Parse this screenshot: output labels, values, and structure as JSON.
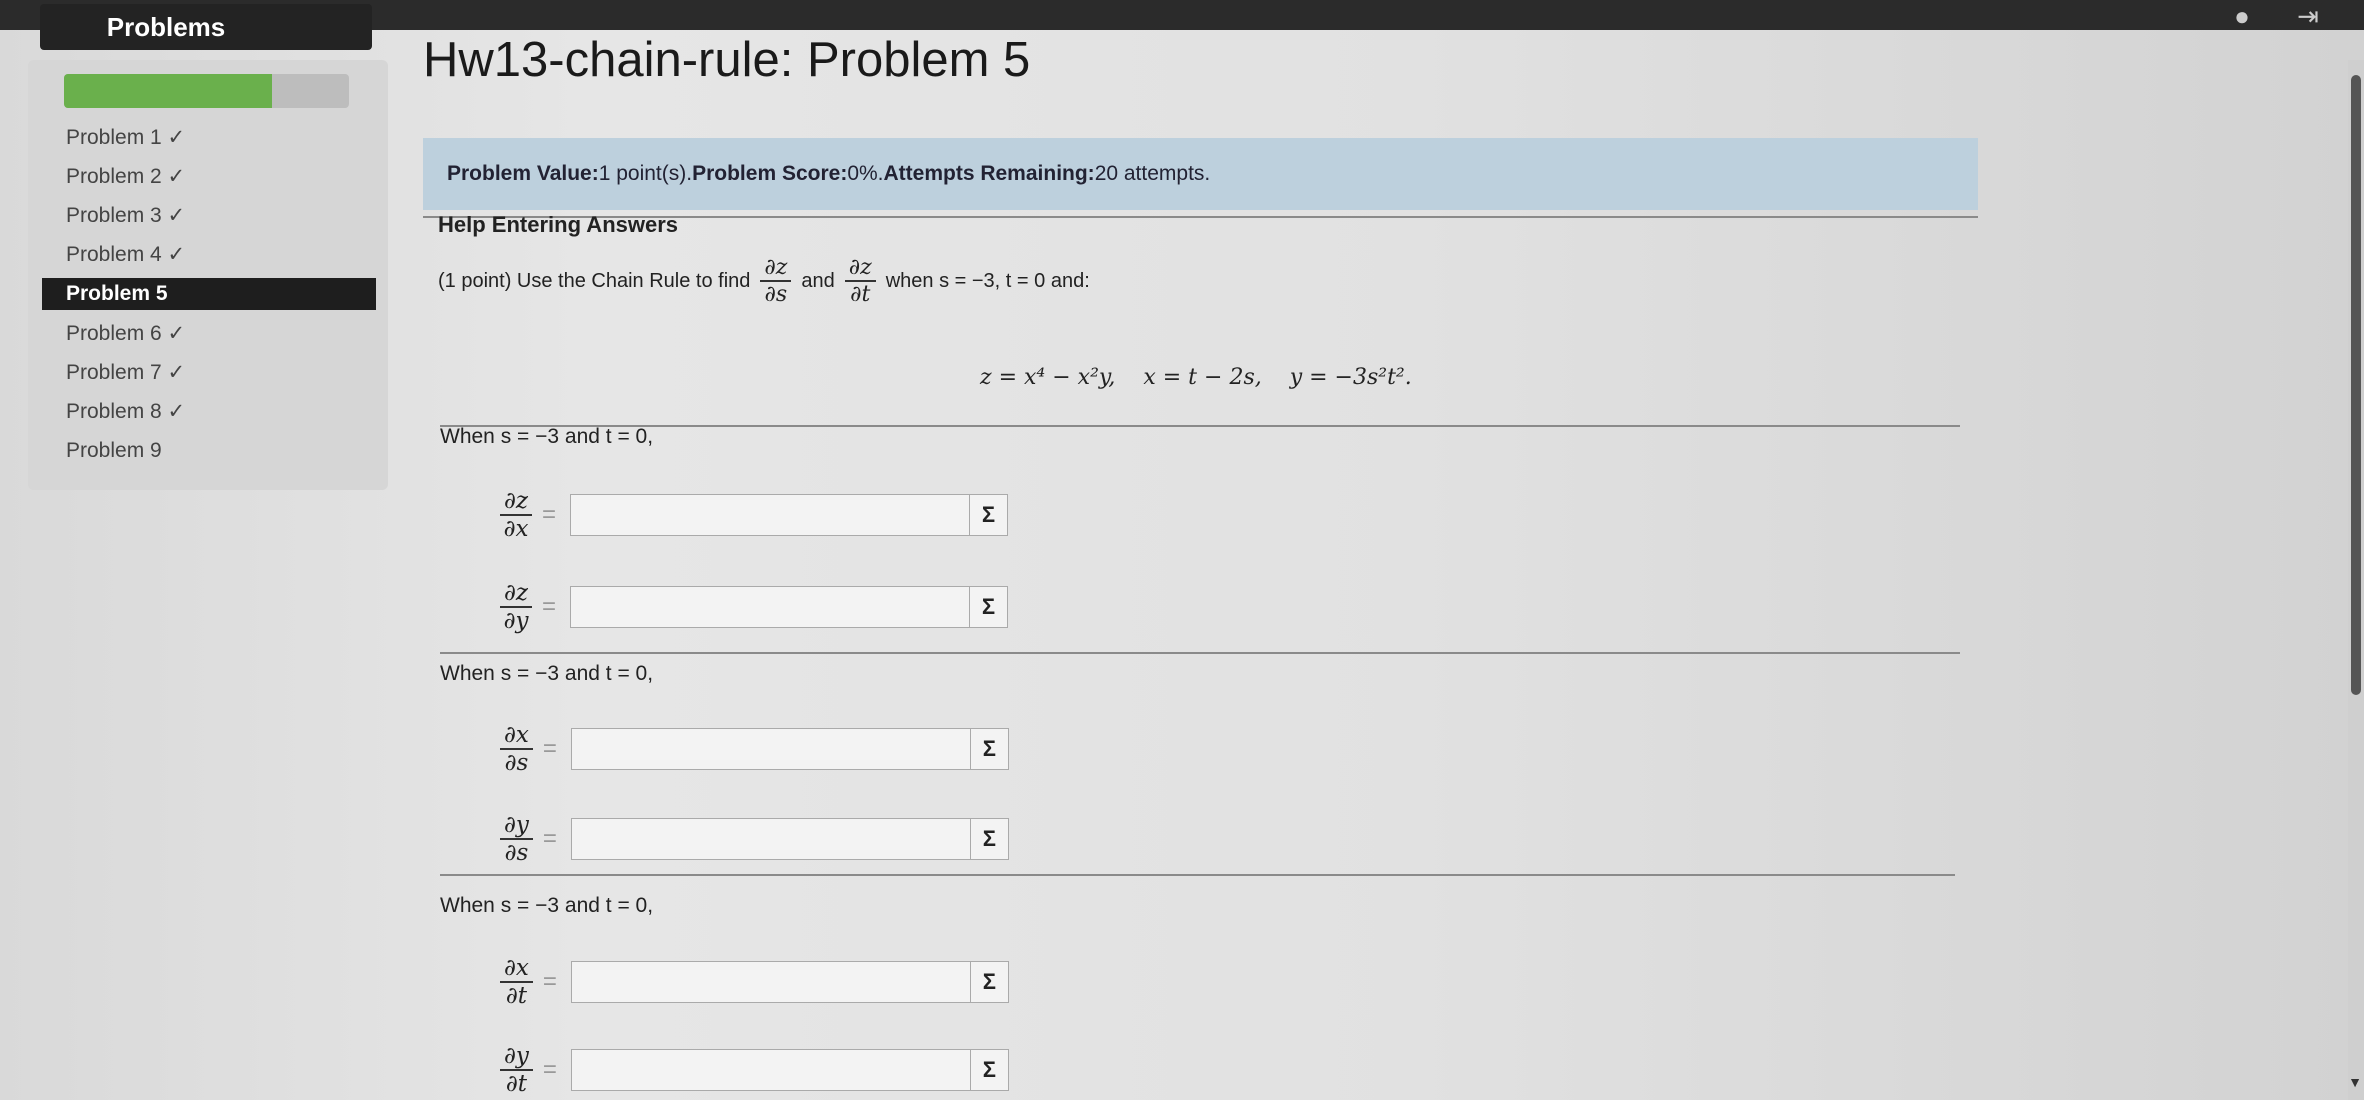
{
  "sidebar": {
    "header": "Problems",
    "progress": 0.73,
    "problems": [
      {
        "label": "Problem 1 ✓",
        "active": false
      },
      {
        "label": "Problem 2 ✓",
        "active": false
      },
      {
        "label": "Problem 3 ✓",
        "active": false
      },
      {
        "label": "Problem 4 ✓",
        "active": false
      },
      {
        "label": "Problem 5",
        "active": true
      },
      {
        "label": "Problem 6 ✓",
        "active": false
      },
      {
        "label": "Problem 7 ✓",
        "active": false
      },
      {
        "label": "Problem 8 ✓",
        "active": false
      },
      {
        "label": "Problem 9",
        "active": false
      }
    ]
  },
  "topbar": {
    "icons": [
      "user-icon",
      "logout-icon"
    ]
  },
  "page": {
    "title": "Hw13-chain-rule: Problem 5",
    "value_prefix": "Problem Value:",
    "value_text": " 1 point(s). ",
    "score_prefix": "Problem Score:",
    "score_text": " 0%. ",
    "attempts_prefix": "Attempts Remaining:",
    "attempts_text": " 20 attempts.",
    "help": "Help Entering Answers",
    "question_pre": "(1 point) Use the Chain Rule to find",
    "question_and": "and",
    "question_when": "when s = −3, t = 0 and:",
    "frac1_num": "∂z",
    "frac1_den": "∂s",
    "frac2_num": "∂z",
    "frac2_den": "∂t",
    "equation": "z = x⁴ − x²y,    x = t − 2s,    y = −3s²t².",
    "sections": [
      {
        "when": "When s = −3 and t = 0,",
        "rows": [
          {
            "num": "∂z",
            "den": "∂x"
          },
          {
            "num": "∂z",
            "den": "∂y"
          }
        ]
      },
      {
        "when": "When s = −3 and t = 0,",
        "rows": [
          {
            "num": "∂x",
            "den": "∂s"
          },
          {
            "num": "∂y",
            "den": "∂s"
          }
        ]
      },
      {
        "when": "When s = −3 and t = 0,",
        "rows": [
          {
            "num": "∂x",
            "den": "∂t"
          },
          {
            "num": "∂y",
            "den": "∂t"
          }
        ]
      }
    ],
    "equals": "=",
    "sigma": "Σ"
  }
}
